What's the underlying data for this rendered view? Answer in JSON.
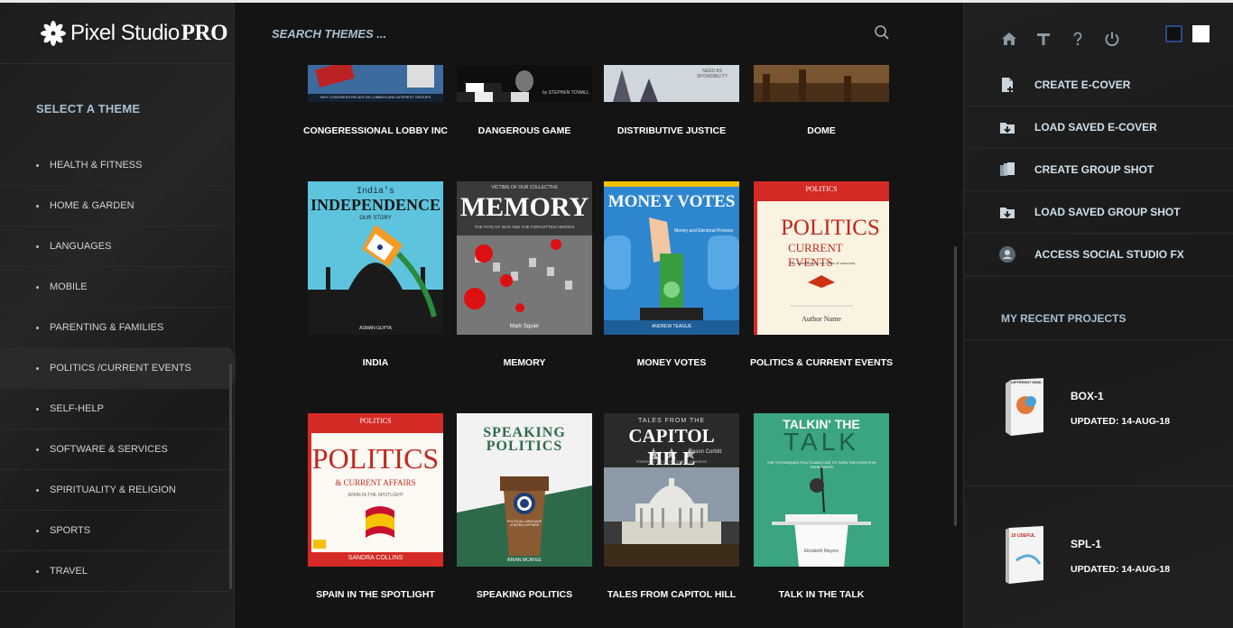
{
  "app": {
    "logo_name": "Pixel Studio",
    "logo_pro": "PRO"
  },
  "sidebar": {
    "title": "SELECT A THEME",
    "items": [
      {
        "label": "HEALTH & FITNESS"
      },
      {
        "label": "HOME & GARDEN"
      },
      {
        "label": "LANGUAGES"
      },
      {
        "label": "MOBILE"
      },
      {
        "label": "PARENTING & FAMILIES"
      },
      {
        "label": "POLITICS /CURRENT EVENTS",
        "active": true
      },
      {
        "label": "SELF-HELP"
      },
      {
        "label": "SOFTWARE & SERVICES"
      },
      {
        "label": "SPIRITUALITY & RELIGION"
      },
      {
        "label": "SPORTS"
      },
      {
        "label": "TRAVEL"
      }
    ]
  },
  "search": {
    "placeholder": "SEARCH THEMES ..."
  },
  "themes": [
    {
      "label": "CONGERESSIONAL LOBBY INC",
      "cover_text": "WHY CONGRESS RELIES ON LOBBIES AND INTEREST GROUPS"
    },
    {
      "label": "DANGEROUS GAME",
      "cover_text": "by STEPHEN TOWALL"
    },
    {
      "label": "DISTRIBUTIVE JUSTICE",
      "cover_text": "NEED AS SPONSIBILITY"
    },
    {
      "label": "DOME",
      "cover_text": ""
    },
    {
      "label": "INDIA",
      "cover_title": "INDEPENDENCE",
      "cover_top": "India's",
      "cover_sub": "OUR STORY",
      "cover_author": "ASMAN GUPTA"
    },
    {
      "label": "MEMORY",
      "cover_title": "MEMORY",
      "cover_top": "VICTIMS OF OUR COLLECTIVE",
      "cover_sub": "THE FATE OF WAR AND THE FORGOTTEN HEROES",
      "cover_author": "Mark Squier"
    },
    {
      "label": "MONEY VOTES",
      "cover_title": "MONEY VOTES",
      "cover_sub": "Money and Electoral Process",
      "cover_author": "ANDREW TEAGUE"
    },
    {
      "label": "POLITICS & CURRENT EVENTS",
      "cover_title": "POLITICS",
      "cover_top": "POLITICS",
      "cover_sub": "CURRENT EVENTS",
      "cover_tagline": "Our world today & the future of tomorrow",
      "cover_author": "Author Name"
    },
    {
      "label": "SPAIN IN THE SPOTLIGHT",
      "cover_title": "POLITICS",
      "cover_top": "POLITICS",
      "cover_sub": "& CURRENT AFFAIRS",
      "cover_tagline": "SPAIN IN THE SPOTLIGHT",
      "cover_author": "SANDRA COLLINS"
    },
    {
      "label": "SPEAKING POLITICS",
      "cover_title": "SPEAKING POLITICS",
      "cover_sub": "POLITICAL LANGUAGE of WORLD AFFAIRS",
      "cover_author": "BRIAN MCAFEE"
    },
    {
      "label": "TALES FROM CAPITOL HILL",
      "cover_top": "TALES FROM THE",
      "cover_title": "CAPITOL HILL",
      "cover_author": "Jason Corbitt",
      "cover_sub": "POWERS OF THE UNITED STATES CONGRESS"
    },
    {
      "label": "TALK IN THE TALK",
      "cover_top": "TALKIN' THE",
      "cover_title": "TALK",
      "cover_sub": "THE TECHNIQUES POLITICIANS USE TO TURN THE EVENTS IN THEIR FAVOR",
      "cover_author": "Elizabeth Mayers"
    }
  ],
  "right": {
    "actions": [
      {
        "label": "CREATE E-COVER",
        "icon": "file-add-icon"
      },
      {
        "label": "LOAD SAVED E-COVER",
        "icon": "folder-load-icon"
      },
      {
        "label": "CREATE GROUP SHOT",
        "icon": "group-file-icon"
      },
      {
        "label": "LOAD SAVED GROUP SHOT",
        "icon": "folder-load-icon"
      },
      {
        "label": "ACCESS SOCIAL STUDIO FX",
        "icon": "social-icon"
      }
    ],
    "recent_title": "MY RECENT PROJECTS",
    "recent": [
      {
        "name": "BOX-1",
        "date": "UPDATED: 14-AUG-18",
        "thumb_text": "DIFFERENT MIND"
      },
      {
        "name": "SPL-1",
        "date": "UPDATED: 14-AUG-18",
        "thumb_text": "10 USEFUL"
      }
    ]
  },
  "colors": {
    "accent_text": "#a9bfd0",
    "background": "#151515"
  }
}
